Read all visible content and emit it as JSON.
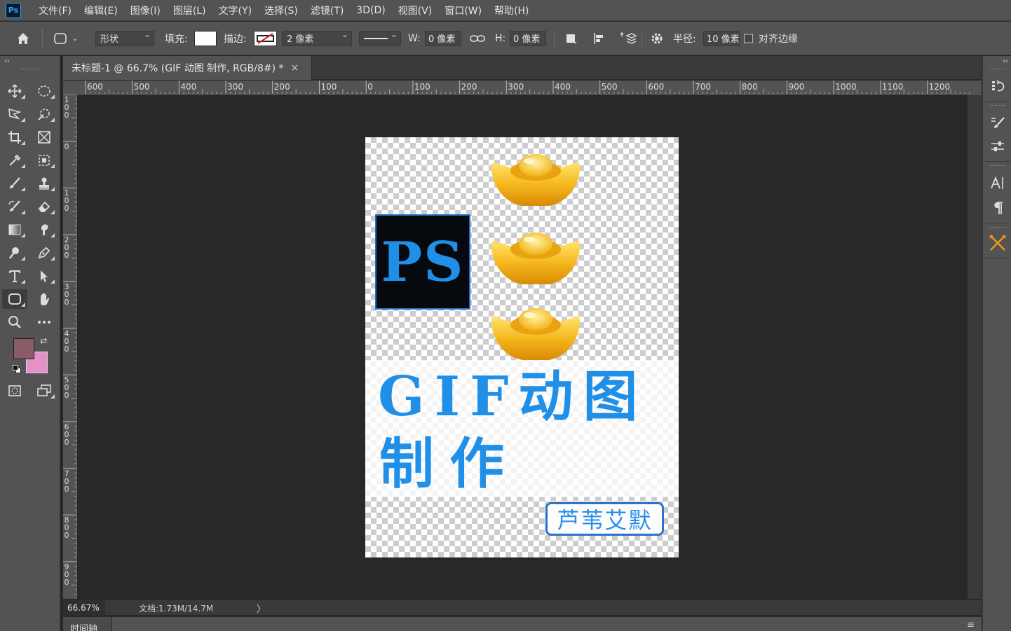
{
  "app": {
    "logo": "Ps"
  },
  "menu": [
    "文件(F)",
    "编辑(E)",
    "图像(I)",
    "图层(L)",
    "文字(Y)",
    "选择(S)",
    "滤镜(T)",
    "3D(D)",
    "视图(V)",
    "窗口(W)",
    "帮助(H)"
  ],
  "options": {
    "mode": "形状",
    "fill_label": "填充:",
    "stroke_label": "描边:",
    "stroke_width": "2 像素",
    "w_label": "W:",
    "w_value": "0 像素",
    "h_label": "H:",
    "h_value": "0 像素",
    "radius_label": "半径:",
    "radius_value": "10 像素",
    "align_edges": "对齐边缘"
  },
  "document": {
    "tab_title": "未标题-1 @ 66.7% (GIF 动图   制作, RGB/8#) *",
    "close": "×"
  },
  "ruler_top": [
    "600",
    "500",
    "400",
    "300",
    "200",
    "100",
    "0",
    "100",
    "200",
    "300",
    "400",
    "500",
    "600",
    "700",
    "800",
    "900",
    "1000",
    "1100",
    "1200"
  ],
  "ruler_left": [
    "100",
    "0",
    "100",
    "200",
    "300",
    "400",
    "500",
    "600",
    "700",
    "800",
    "900"
  ],
  "canvas": {
    "ps_text": "PS",
    "title_line1": "GIF动图",
    "title_line2": "制作",
    "signature": "芦苇艾默"
  },
  "status": {
    "zoom": "66.67%",
    "doc_info": "文档:1.73M/14.7M",
    "arrow": "〉"
  },
  "timeline": {
    "tab": "时间轴",
    "menu": "≡"
  },
  "colors": {
    "foreground": "#8b5c67",
    "background": "#e591c8",
    "accent_blue": "#1f8fe8"
  }
}
